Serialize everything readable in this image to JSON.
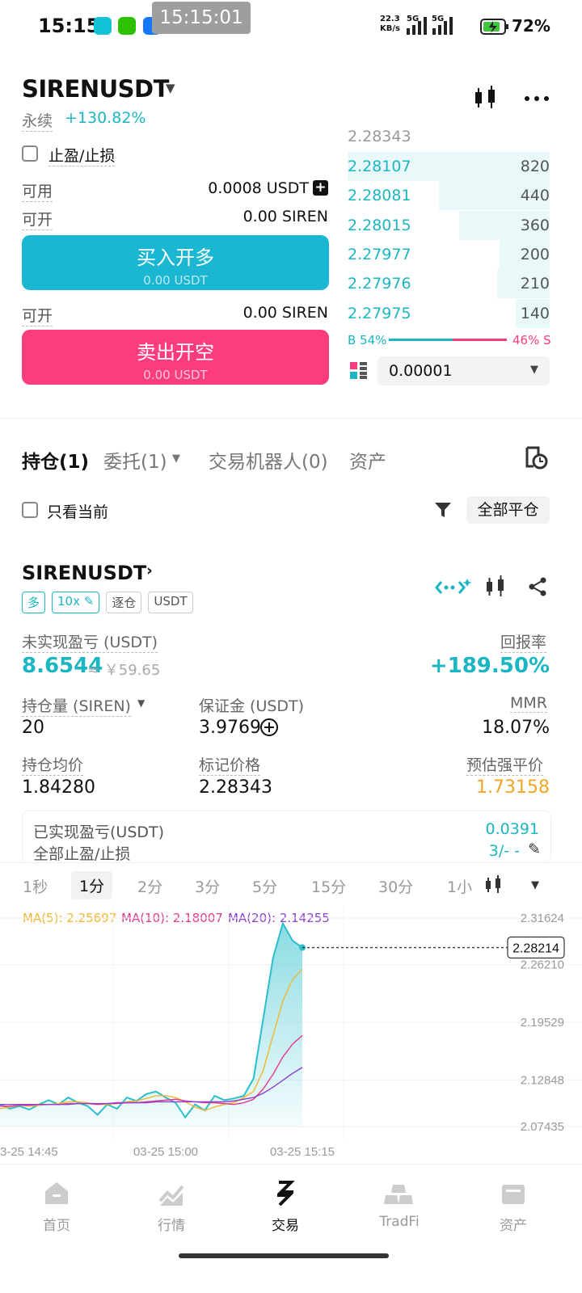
{
  "status": {
    "time": "15:15",
    "overlay_clock": "15:15:01",
    "net_speed": "22.3",
    "net_unit": "KB/s",
    "sig1_label": "5G",
    "sig2_label": "5G",
    "battery": "72%"
  },
  "header": {
    "symbol": "SIRENUSDT",
    "type": "永续",
    "change": "+130.82%"
  },
  "order_form": {
    "tpsl_label": "止盈/止损",
    "available_label": "可用",
    "available_value": "0.0008 USDT",
    "open_label": "可开",
    "open_value": "0.00 SIREN",
    "buy_label": "买入开多",
    "buy_sub": "0.00 USDT",
    "open_label_2": "可开",
    "open_value_2": "0.00 SIREN",
    "sell_label": "卖出开空",
    "sell_sub": "0.00 USDT"
  },
  "orderbook": {
    "partial_price": "2.28343",
    "rows": [
      {
        "price": "2.28107",
        "qty": "820",
        "depth": 1.0
      },
      {
        "price": "2.28081",
        "qty": "440",
        "depth": 0.55
      },
      {
        "price": "2.28015",
        "qty": "360",
        "depth": 0.45
      },
      {
        "price": "2.27977",
        "qty": "200",
        "depth": 0.25
      },
      {
        "price": "2.27976",
        "qty": "210",
        "depth": 0.26
      },
      {
        "price": "2.27975",
        "qty": "140",
        "depth": 0.17
      }
    ],
    "buy_ratio_label": "B 54%",
    "sell_ratio_label": "46% S",
    "buy_ratio": 0.54,
    "precision": "0.00001"
  },
  "tabs": {
    "positions": "持仓(1)",
    "orders": "委托(1)",
    "bots": "交易机器人(0)",
    "assets": "资产"
  },
  "filter": {
    "current_only": "只看当前",
    "close_all": "全部平仓"
  },
  "position": {
    "symbol": "SIRENUSDT",
    "side": "多",
    "leverage": "10x",
    "margin_mode": "逐仓",
    "quote": "USDT",
    "unrealized_label": "未实现盈亏 (USDT)",
    "unrealized_value": "8.6544",
    "unrealized_cny": "≈ ￥59.65",
    "roe_label": "回报率",
    "roe_value": "+189.50%",
    "size_label": "持仓量 (SIREN)",
    "size_value": "20",
    "margin_label": "保证金 (USDT)",
    "margin_value": "3.9769",
    "mmr_label": "MMR",
    "mmr_value": "18.07%",
    "entry_label": "持仓均价",
    "entry_value": "1.84280",
    "mark_label": "标记价格",
    "mark_value": "2.28343",
    "liq_label": "预估强平价",
    "liq_value": "1.73158",
    "realized_label": "已实现盈亏(USDT)",
    "realized_value": "0.0391",
    "tpsl_all_label": "全部止盈/止损",
    "tpsl_all_value": "3/- -"
  },
  "chart_toolbar": {
    "timeframes": [
      "1秒",
      "1分",
      "2分",
      "3分",
      "5分",
      "15分",
      "30分",
      "1小"
    ],
    "active": "1分"
  },
  "ma_legend": {
    "ma5": "MA(5): 2.25697",
    "ma10": "MA(10): 2.18007",
    "ma20": "MA(20): 2.14255"
  },
  "chart_data": {
    "type": "line",
    "y_ticks": [
      "2.31624",
      "2.26210",
      "2.19529",
      "2.12848",
      "2.07435"
    ],
    "ylim": [
      2.07435,
      2.31624
    ],
    "x_ticks": [
      "03-25 14:45",
      "03-25 15:00",
      "03-25 15:15"
    ],
    "current_price": "2.28214",
    "colors": {
      "price": "#2bbfcc",
      "ma5": "#f2b62f",
      "ma10": "#e0398e",
      "ma20": "#8e3fd0"
    },
    "series": [
      {
        "name": "price",
        "values": [
          2.1,
          2.095,
          2.098,
          2.094,
          2.1,
          2.105,
          2.1,
          2.108,
          2.102,
          2.098,
          2.088,
          2.1,
          2.095,
          2.108,
          2.104,
          2.112,
          2.115,
          2.108,
          2.102,
          2.085,
          2.1,
          2.093,
          2.11,
          2.105,
          2.107,
          2.11,
          2.13,
          2.2,
          2.27,
          2.31,
          2.29,
          2.282
        ]
      },
      {
        "name": "MA(5)",
        "values": [
          2.095,
          2.097,
          2.099,
          2.098,
          2.099,
          2.1,
          2.101,
          2.103,
          2.103,
          2.102,
          2.1,
          2.1,
          2.101,
          2.103,
          2.104,
          2.107,
          2.11,
          2.11,
          2.108,
          2.103,
          2.097,
          2.093,
          2.097,
          2.1,
          2.102,
          2.108,
          2.115,
          2.14,
          2.18,
          2.22,
          2.245,
          2.257
        ]
      },
      {
        "name": "MA(10)",
        "values": [
          2.098,
          2.098,
          2.099,
          2.099,
          2.1,
          2.1,
          2.1,
          2.101,
          2.101,
          2.101,
          2.1,
          2.101,
          2.101,
          2.102,
          2.102,
          2.103,
          2.104,
          2.105,
          2.106,
          2.104,
          2.103,
          2.102,
          2.102,
          2.101,
          2.1,
          2.102,
          2.106,
          2.118,
          2.135,
          2.155,
          2.17,
          2.18
        ]
      },
      {
        "name": "MA(20)",
        "values": [
          2.1,
          2.1,
          2.1,
          2.1,
          2.1,
          2.1,
          2.1,
          2.1,
          2.101,
          2.101,
          2.101,
          2.101,
          2.102,
          2.102,
          2.102,
          2.102,
          2.103,
          2.103,
          2.103,
          2.103,
          2.103,
          2.103,
          2.103,
          2.103,
          2.104,
          2.106,
          2.108,
          2.113,
          2.12,
          2.128,
          2.136,
          2.143
        ]
      }
    ]
  },
  "bottom_nav": {
    "home": "首页",
    "market": "行情",
    "trade": "交易",
    "tradfi": "TradFi",
    "assets": "资产"
  }
}
